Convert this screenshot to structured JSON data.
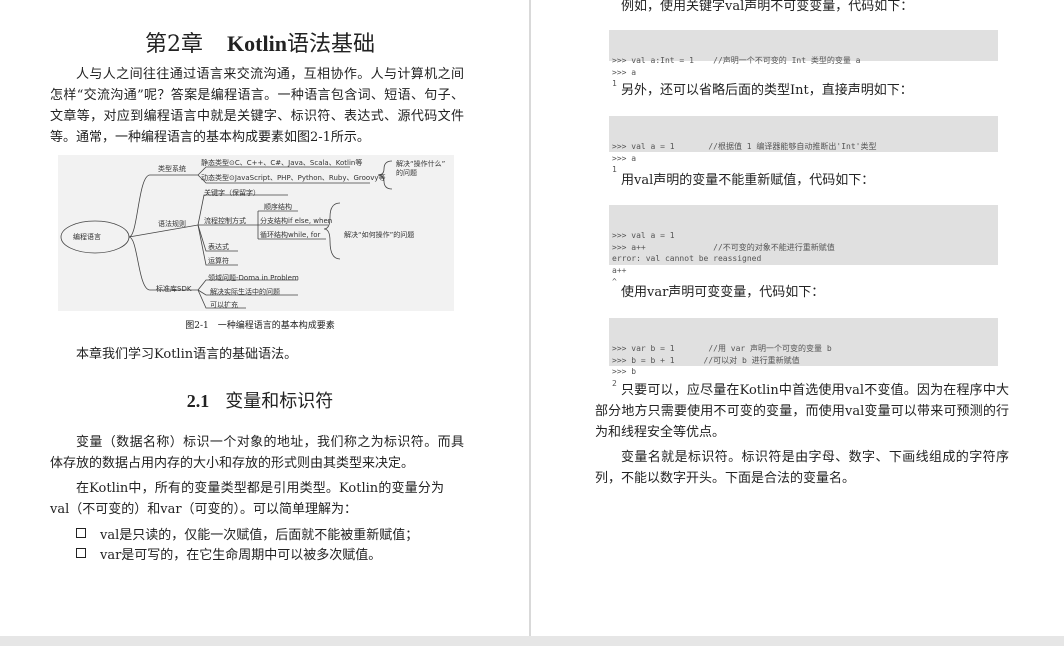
{
  "left": {
    "chapter": {
      "number": "第2章",
      "name_kw": "Kotlin",
      "name_rest": "语法基础"
    },
    "intro": "人与人之间往往通过语言来交流沟通，互相协作。人与计算机之间怎样“交流沟通”呢？答案是编程语言。一种语言包含词、短语、句子、文章等，对应到编程语言中就是关键字、标识符、表达式、源代码文件等。通常，一种编程语言的基本构成要素如图2-1所示。",
    "mindmap": {
      "root": "编程语言",
      "type_system": "类型系统",
      "static_types": "静态类型⊙C、C++、C#、Java、Scala、Kotlin等",
      "dynamic_types": "动态类型⊙JavaScript、PHP、Python、Ruby、Groovy等",
      "solve_what_1": "解决“操作什么”",
      "solve_what_2": "的问题",
      "keyword": "关键字（保留字）",
      "syntax_rules": "语法规则",
      "flow_control": "流程控制方式",
      "sequence": "顺序结构",
      "branch": "分支结构if else, when",
      "loop": "循环结构while, for",
      "expression": "表达式",
      "operator": "运算符",
      "solve_how": "解决“如何操作”的问题",
      "sdk": "标准库SDK",
      "domain": "领域问题-Doma in Problem",
      "real_life": "解决实际生活中的问题",
      "extensible": "可以扩充",
      "caption": "图2-1　一种编程语言的基本构成要素"
    },
    "chapter_note": "本章我们学习Kotlin语言的基础语法。",
    "section": {
      "number": "2.1",
      "title": "变量和标识符"
    },
    "p1": "变量（数据名称）标识一个对象的地址，我们称之为标识符。而具体存放的数据占用内存的大小和存放的形式则由其类型来决定。",
    "p2": "在Kotlin中，所有的变量类型都是引用类型。Kotlin的变量分为val（不可变的）和var（可变的）。可以简单理解为：",
    "bullets": [
      "val是只读的，仅能一次赋值，后面就不能被重新赋值；",
      "var是可写的，在它生命周期中可以被多次赋值。"
    ]
  },
  "right": {
    "t1": "例如，使用关键字val声明不可变变量，代码如下：",
    "code1": [
      ">>> val a:Int = 1    //声明一个不可变的 Int 类型的变量 a",
      ">>> a",
      "1"
    ],
    "t2": "另外，还可以省略后面的类型Int，直接声明如下：",
    "code2": [
      ">>> val a = 1       //根据值 1 编译器能够自动推断出'Int'类型",
      ">>> a",
      "1"
    ],
    "t3": "用val声明的变量不能重新赋值，代码如下：",
    "code3": [
      ">>> val a = 1",
      ">>> a++              //不可变的对象不能进行重新赋值",
      "error: val cannot be reassigned",
      "a++",
      "^"
    ],
    "t4": "使用var声明可变变量，代码如下：",
    "code4": [
      ">>> var b = 1       //用 var 声明一个可变的变量 b",
      ">>> b = b + 1      //可以对 b 进行重新赋值",
      ">>> b",
      "2"
    ],
    "p5": "只要可以，应尽量在Kotlin中首选使用val不变值。因为在程序中大部分地方只需要使用不可变的变量，而使用val变量可以带来可预测的行为和线程安全等优点。",
    "p6": "变量名就是标识符。标识符是由字母、数字、下画线组成的字符序列，不能以数字开头。下面是合法的变量名。"
  }
}
